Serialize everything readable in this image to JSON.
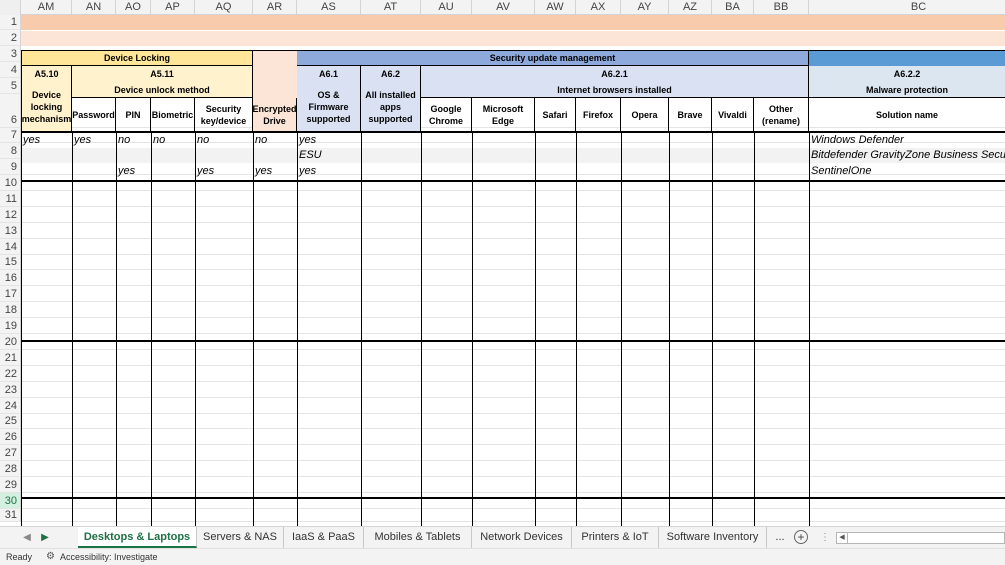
{
  "colors": {
    "row1_fill": "#f8cbad",
    "row2_fill": "#fce4d6",
    "locking_header_fill": "#ffe699",
    "locking_sub_fill": "#fff2cc",
    "security_header_fill": "#8ea9db",
    "security_sub_fill": "#d9e1f2",
    "malware_fill": "#dce6f1",
    "accent": "#1e7145",
    "stripe_fill": "#f2f2f2"
  },
  "column_letters": [
    "AM",
    "AN",
    "AO",
    "AP",
    "AQ",
    "AR",
    "AS",
    "AT",
    "AU",
    "AV",
    "AW",
    "AX",
    "AY",
    "AZ",
    "BA",
    "BB",
    "BC"
  ],
  "row_numbers": [
    "1",
    "2",
    "3",
    "4",
    "5",
    "6",
    "7",
    "8",
    "9",
    "10",
    "11",
    "12",
    "13",
    "14",
    "15",
    "16",
    "17",
    "18",
    "19",
    "20",
    "21",
    "22",
    "23",
    "24",
    "25",
    "26",
    "27",
    "28",
    "29",
    "30",
    "31"
  ],
  "selected_row": "30",
  "headers": {
    "device_locking": "Device Locking",
    "security_update_management": "Security update management",
    "a5_10": "A5.10",
    "a5_11": "A5.11",
    "device_unlock_method": "Device  unlock method",
    "device_locking_mechanism": "Device locking mechanism",
    "password": "Password",
    "pin": "PIN",
    "biometric": "Biometric",
    "security_key_device": "Security key/device",
    "encrypted_drive": "Encrypted Drive",
    "a6_1": "A6.1",
    "os_firmware_supported": "OS & Firmware supported",
    "a6_2": "A6.2",
    "all_installed_apps_supported": "All installed apps supported",
    "a6_2_1": "A6.2.1",
    "internet_browsers_installed": "Internet browsers installed",
    "google_chrome": "Google Chrome",
    "microsoft_edge": "Microsoft Edge",
    "safari": "Safari",
    "firefox": "Firefox",
    "opera": "Opera",
    "brave": "Brave",
    "vivaldi": "Vivaldi",
    "other_rename": "Other (rename)",
    "a6_2_2": "A6.2.2",
    "malware_protection": "Malware protection",
    "solution_name": "Solution name"
  },
  "rows": [
    {
      "AM": "yes",
      "AN": "yes",
      "AO": "no",
      "AP": "no",
      "AQ": "no",
      "AR": "no",
      "AS": "yes",
      "BC": "Windows Defender"
    },
    {
      "AS": "ESU",
      "BC": "Bitdefender GravityZone Business Security"
    },
    {
      "AO": "yes",
      "AQ": "yes",
      "AR": "yes",
      "AS": "yes",
      "BC": "SentinelOne"
    }
  ],
  "tabs": [
    "Desktops & Laptops",
    "Servers & NAS",
    "IaaS & PaaS",
    "Mobiles & Tablets",
    "Network Devices",
    "Printers & IoT",
    "Software Inventory"
  ],
  "active_tab": "Desktops & Laptops",
  "more_tabs": "...",
  "status": {
    "ready": "Ready",
    "accessibility": "Accessibility: Investigate"
  }
}
